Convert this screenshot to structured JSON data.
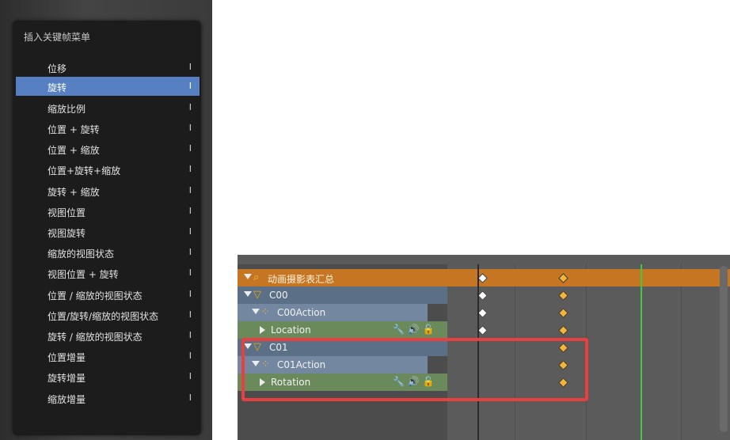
{
  "menu": {
    "title": "插入关键帧菜单",
    "items": [
      {
        "label": "位移",
        "shortcut": "I"
      },
      {
        "label": "旋转",
        "shortcut": "I",
        "active": true
      },
      {
        "label": "缩放比例",
        "shortcut": "I"
      },
      {
        "label": "位置 + 旋转",
        "shortcut": "I"
      },
      {
        "label": "位置 + 缩放",
        "shortcut": "I"
      },
      {
        "label": "位置+旋转+缩放",
        "shortcut": "I"
      },
      {
        "label": "旋转 + 缩放",
        "shortcut": "I"
      },
      {
        "label": "视图位置",
        "shortcut": "I"
      },
      {
        "label": "视图旋转",
        "shortcut": "I"
      },
      {
        "label": "缩放的视图状态",
        "shortcut": "I"
      },
      {
        "label": "视图位置 + 旋转",
        "shortcut": "I"
      },
      {
        "label": "位置 / 缩放的视图状态",
        "shortcut": "I"
      },
      {
        "label": "位置/旋转/缩放的视图状态",
        "shortcut": "I"
      },
      {
        "label": "旋转 / 缩放的视图状态",
        "shortcut": "I"
      },
      {
        "label": "位置增量",
        "shortcut": "I"
      },
      {
        "label": "旋转增量",
        "shortcut": "I"
      },
      {
        "label": "缩放增量",
        "shortcut": "I"
      }
    ]
  },
  "dopesheet": {
    "rows": [
      {
        "label": "动画摄影表汇总",
        "kind": "summary",
        "icon": "dopesheet-icon",
        "keys": [
          "white",
          "yellow"
        ]
      },
      {
        "label": "C00",
        "kind": "object",
        "icon": "camera-icon",
        "keys": [
          "white",
          "yellow"
        ]
      },
      {
        "label": "C00Action",
        "kind": "action",
        "icon": "action-icon",
        "keys": [
          "white",
          "yellow"
        ]
      },
      {
        "label": "Location",
        "kind": "channel",
        "keys": [
          "white",
          "yellow"
        ]
      },
      {
        "label": "C01",
        "kind": "object",
        "icon": "camera-icon",
        "keys": [
          "yellow"
        ]
      },
      {
        "label": "C01Action",
        "kind": "action",
        "icon": "action-icon",
        "keys": [
          "yellow"
        ]
      },
      {
        "label": "Rotation",
        "kind": "channel",
        "keys": [
          "yellow"
        ]
      }
    ],
    "colors": {
      "summary": "#c67623",
      "object": "#5b6f86",
      "action": "#7487a0",
      "channel": "#6b8a5b",
      "highlight": "#e84040",
      "current_frame_marker": "#3ec93e",
      "keyframe_selected": "#f2b43a",
      "keyframe_unselected": "#ffffff"
    }
  }
}
